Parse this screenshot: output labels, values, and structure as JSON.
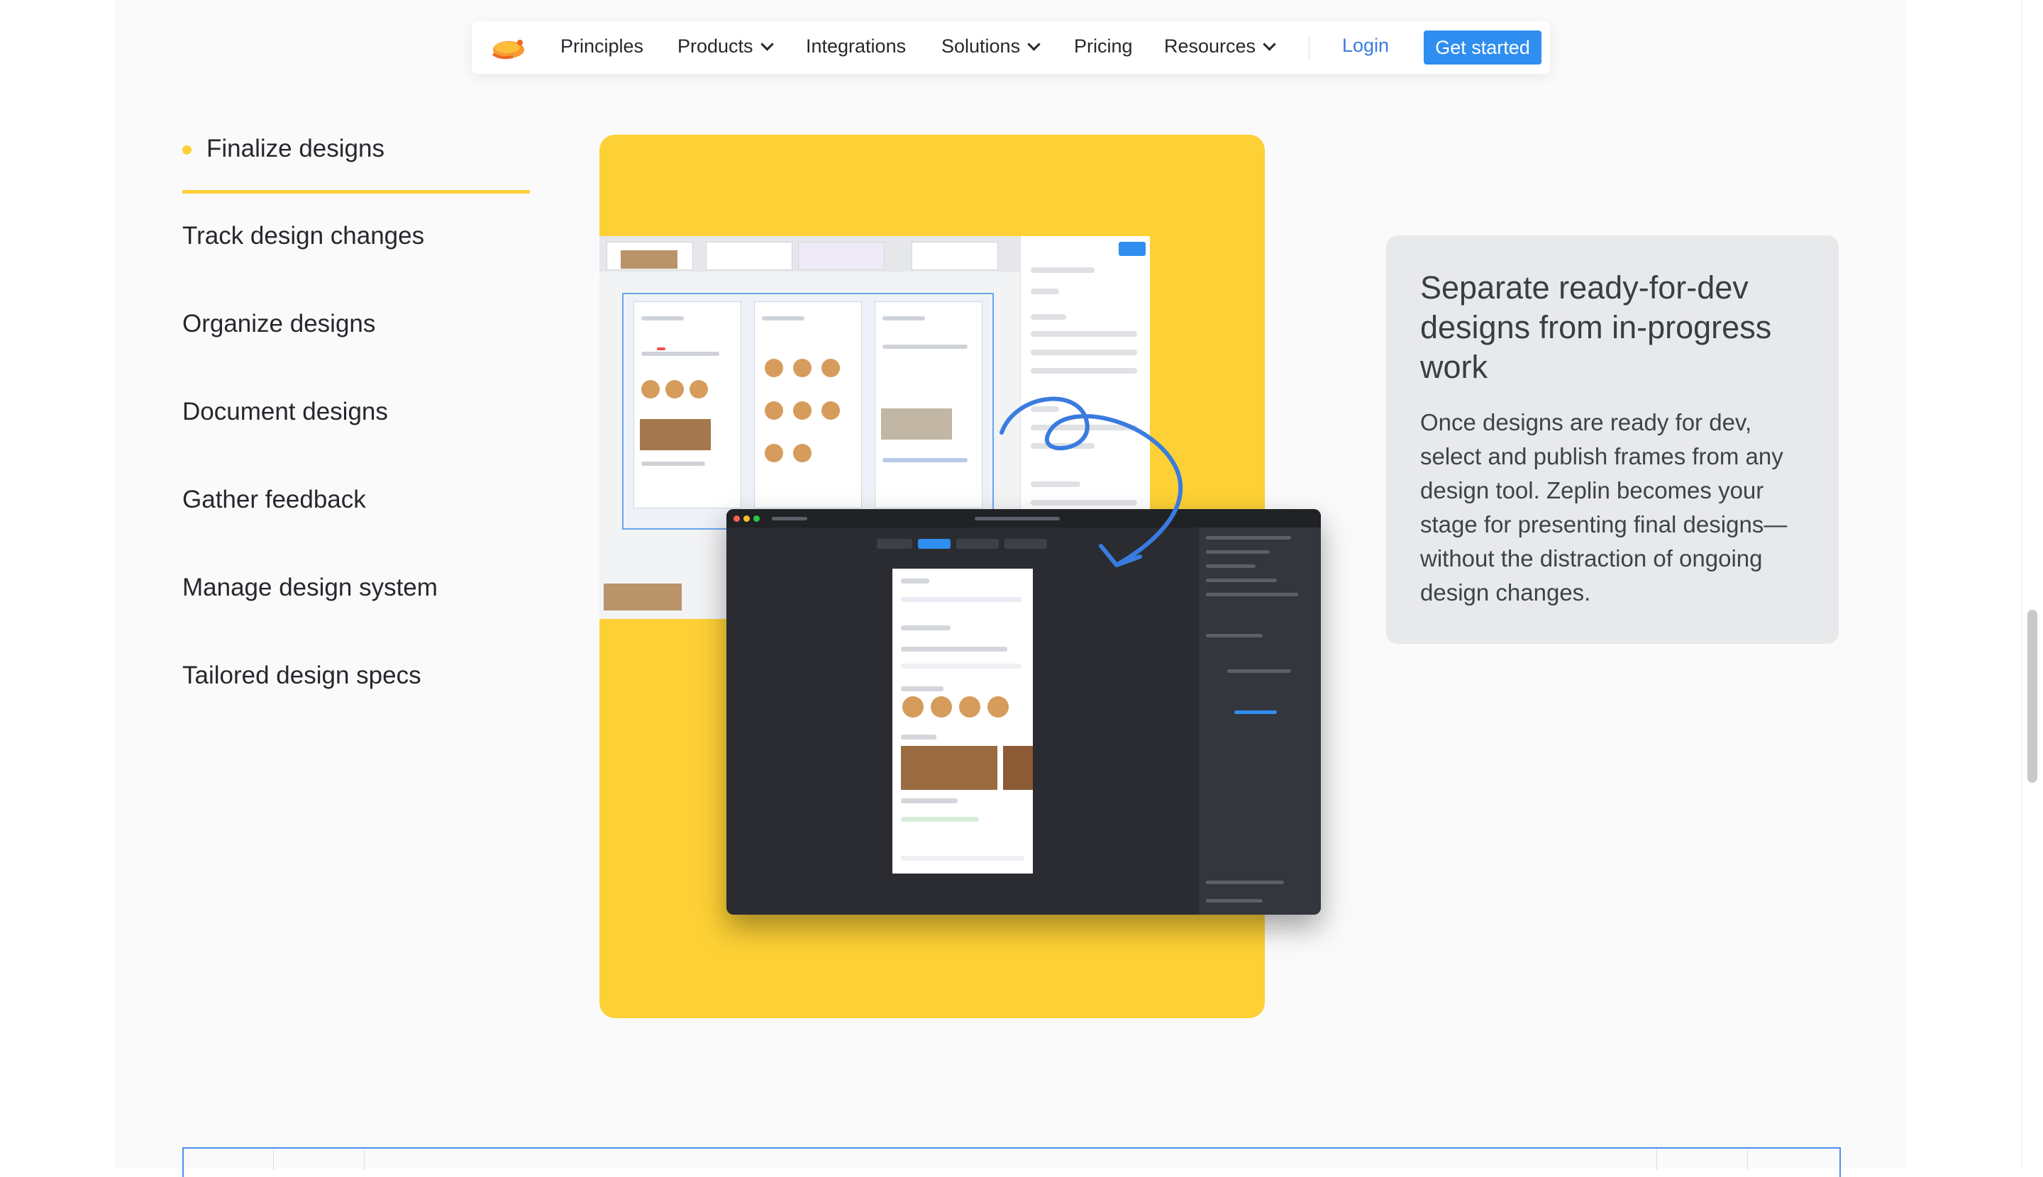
{
  "nav": {
    "items": [
      {
        "label": "Principles",
        "has_dropdown": false
      },
      {
        "label": "Products",
        "has_dropdown": true
      },
      {
        "label": "Integrations",
        "has_dropdown": false
      },
      {
        "label": "Solutions",
        "has_dropdown": true
      },
      {
        "label": "Pricing",
        "has_dropdown": false
      },
      {
        "label": "Resources",
        "has_dropdown": true
      }
    ],
    "login_label": "Login",
    "cta_label": "Get started"
  },
  "features": {
    "active": "Finalize designs",
    "items": [
      "Track design changes",
      "Organize designs",
      "Document designs",
      "Gather feedback",
      "Manage design system",
      "Tailored design specs"
    ]
  },
  "info_card": {
    "title": "Separate ready-for-dev designs from in-progress work",
    "body": "Once designs are ready for dev, select and publish frames from any design tool. Zeplin becomes your stage for presenting final designs—without the distraction of ongoing design changes."
  },
  "colors": {
    "accent_yellow": "#fdd035",
    "brand_blue": "#2f8eef",
    "link_blue": "#3a7be0",
    "text": "#25282c"
  },
  "icons": [
    "zeplin-logo-icon",
    "chevron-down-icon",
    "curved-arrow-icon"
  ]
}
